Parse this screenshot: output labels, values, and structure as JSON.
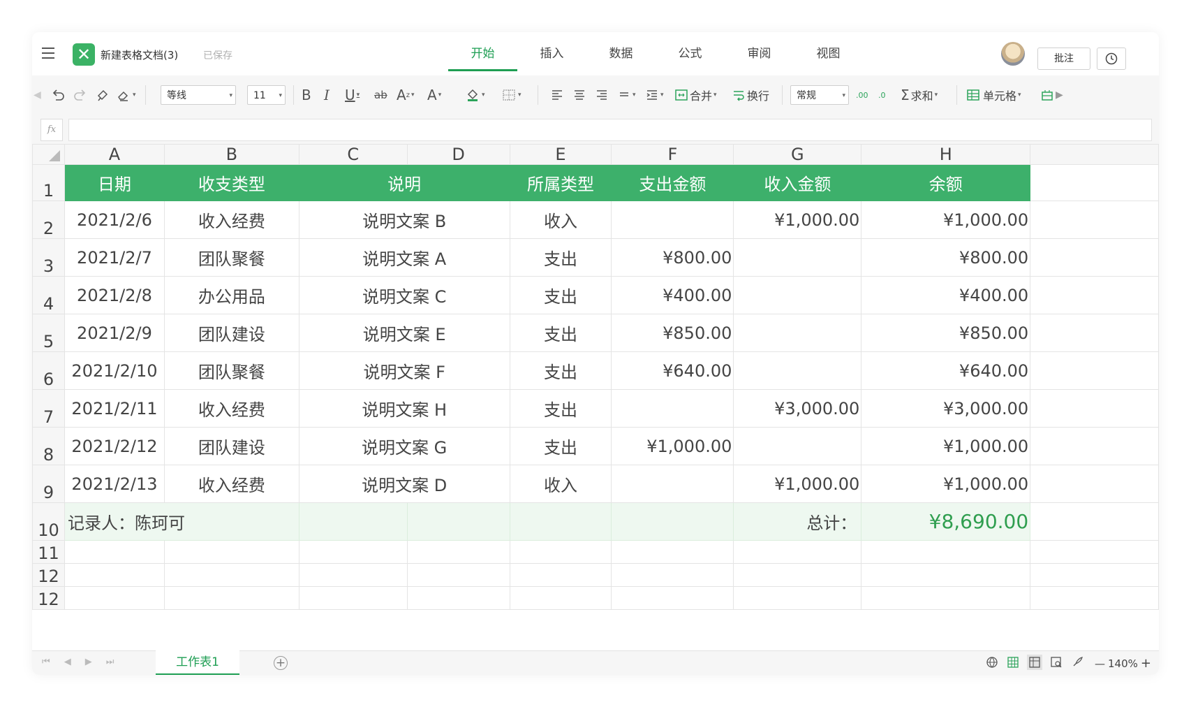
{
  "app": {
    "title": "新建表格文档(3)",
    "save_state": "已保存",
    "tabs": [
      "开始",
      "插入",
      "数据",
      "公式",
      "审阅",
      "视图"
    ],
    "active_tab": "开始",
    "comment_button": "批注"
  },
  "toolbar": {
    "font_name": "等线",
    "font_size": "11",
    "strike_label": "ab",
    "merge_label": "合并",
    "wrap_label": "换行",
    "number_format": "常规",
    "sum_label": "求和",
    "cell_label": "单元格"
  },
  "formula_bar": {
    "fx_label": "fx",
    "value": ""
  },
  "sheet": {
    "columns": [
      "A",
      "B",
      "C",
      "D",
      "E",
      "F",
      "G",
      "H"
    ],
    "row_numbers": [
      "1",
      "2",
      "3",
      "4",
      "5",
      "6",
      "7",
      "8",
      "9",
      "10",
      "11",
      "12",
      "12"
    ],
    "headers": [
      "日期",
      "收支类型",
      "说明",
      "所属类型",
      "支出金额",
      "收入金额",
      "余额"
    ],
    "rows": [
      [
        "2021/2/6",
        "收入经费",
        "说明文案 B",
        "收入",
        "",
        "¥1,000.00",
        "¥1,000.00"
      ],
      [
        "2021/2/7",
        "团队聚餐",
        "说明文案 A",
        "支出",
        "¥800.00",
        "",
        "¥800.00"
      ],
      [
        "2021/2/8",
        "办公用品",
        "说明文案 C",
        "支出",
        "¥400.00",
        "",
        "¥400.00"
      ],
      [
        "2021/2/9",
        "团队建设",
        "说明文案 E",
        "支出",
        "¥850.00",
        "",
        "¥850.00"
      ],
      [
        "2021/2/10",
        "团队聚餐",
        "说明文案 F",
        "支出",
        "¥640.00",
        "",
        "¥640.00"
      ],
      [
        "2021/2/11",
        "收入经费",
        "说明文案 H",
        "支出",
        "",
        "¥3,000.00",
        "¥3,000.00"
      ],
      [
        "2021/2/12",
        "团队建设",
        "说明文案 G",
        "支出",
        "¥1,000.00",
        "",
        "¥1,000.00"
      ],
      [
        "2021/2/13",
        "收入经费",
        "说明文案 D",
        "收入",
        "",
        "¥1,000.00",
        "¥1,000.00"
      ]
    ],
    "recorder": "记录人：陈珂可",
    "total_label": "总计：",
    "total_value": "¥8,690.00",
    "header_color": "#3db06b",
    "total_row_color": "#eef8f0"
  },
  "sheetbar": {
    "sheet_tab": "工作表1",
    "zoom": "140%"
  }
}
